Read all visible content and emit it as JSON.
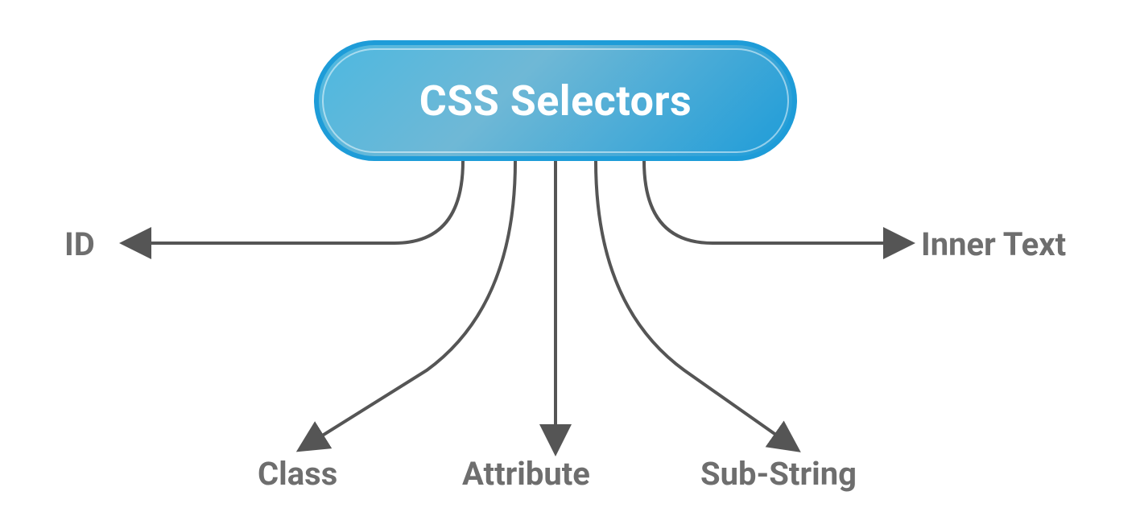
{
  "diagram": {
    "title": "CSS Selectors",
    "branches": {
      "id": "ID",
      "class": "Class",
      "attribute": "Attribute",
      "substring": "Sub-String",
      "innertext": "Inner Text"
    },
    "colors": {
      "pill_border": "#1e9cd8",
      "pill_gradient_start": "#4db8e0",
      "pill_gradient_end": "#1e9cd8",
      "label": "#6e6e6e",
      "arrow": "#555555"
    }
  }
}
